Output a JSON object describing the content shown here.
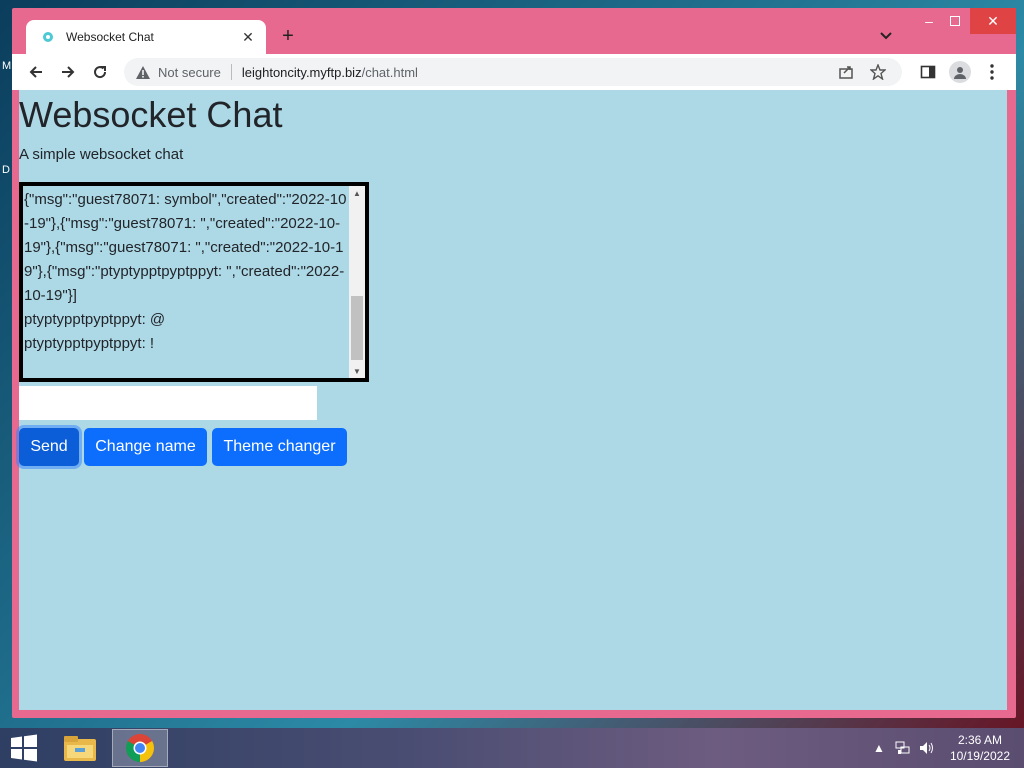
{
  "browser": {
    "tab_title": "Websocket Chat",
    "security_label": "Not secure",
    "url_host": "leightoncity.myftp.biz",
    "url_path": "/chat.html"
  },
  "page": {
    "heading": "Websocket Chat",
    "subtitle": "A simple websocket chat",
    "chat_lines": [
      "{\"msg\":\"guest78071: symbol\",\"created\":\"2022-10-19\"},{\"msg\":\"guest78071: \",\"created\":\"2022-10-19\"},{\"msg\":\"guest78071: \",\"created\":\"2022-10-19\"},{\"msg\":\"ptyptypptpyptppyt: \",\"created\":\"2022-10-19\"}]",
      "ptyptypptpyptppyt: @",
      "ptyptypptpyptppyt: !"
    ],
    "message_input_value": "",
    "send_label": "Send",
    "change_name_label": "Change name",
    "theme_changer_label": "Theme changer"
  },
  "colors": {
    "page_background": "#add8e6",
    "browser_frame": "#e8698f",
    "button_primary": "#0d6efd"
  },
  "taskbar": {
    "clock_time": "2:36 AM",
    "clock_date": "10/19/2022"
  }
}
